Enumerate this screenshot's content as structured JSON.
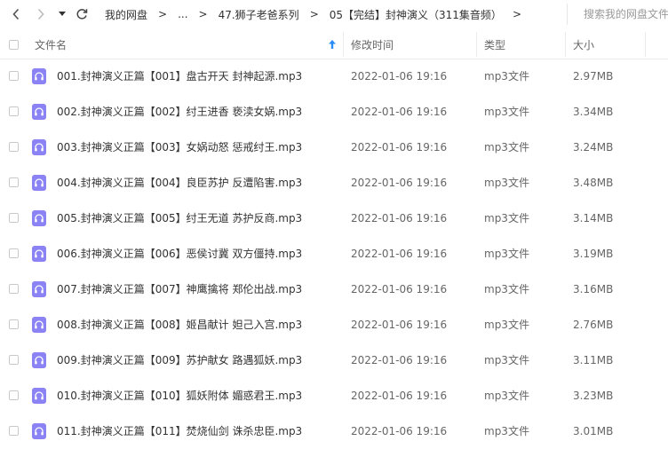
{
  "toolbar": {
    "back_icon": "chevron-left-icon",
    "forward_icon": "chevron-right-icon",
    "dropdown_icon": "caret-down-icon",
    "refresh_icon": "refresh-icon",
    "breadcrumb": [
      "我的网盘",
      "...",
      "47.狮子老爸系列",
      "05【完结】封神演义（311集音频）"
    ],
    "separator": ">",
    "search_placeholder": "搜索我的网盘文件"
  },
  "columns": {
    "name": "文件名",
    "sort_icon": "sort-up-arrow-icon",
    "modified": "修改时间",
    "type": "类型",
    "size": "大小"
  },
  "colors": {
    "accent": "#2a8cf7",
    "file_icon": "#8b83f3"
  },
  "files": [
    {
      "name": "001.封神演义正篇【001】盘古开天 封神起源.mp3",
      "modified": "2022-01-06 19:16",
      "type": "mp3文件",
      "size": "2.97MB"
    },
    {
      "name": "002.封神演义正篇【002】纣王进香 亵渎女娲.mp3",
      "modified": "2022-01-06 19:16",
      "type": "mp3文件",
      "size": "3.34MB"
    },
    {
      "name": "003.封神演义正篇【003】女娲动怒 惩戒纣王.mp3",
      "modified": "2022-01-06 19:16",
      "type": "mp3文件",
      "size": "3.24MB"
    },
    {
      "name": "004.封神演义正篇【004】良臣苏护 反遭陷害.mp3",
      "modified": "2022-01-06 19:16",
      "type": "mp3文件",
      "size": "3.48MB"
    },
    {
      "name": "005.封神演义正篇【005】纣王无道 苏护反商.mp3",
      "modified": "2022-01-06 19:16",
      "type": "mp3文件",
      "size": "3.14MB"
    },
    {
      "name": "006.封神演义正篇【006】恶侯讨冀 双方僵持.mp3",
      "modified": "2022-01-06 19:16",
      "type": "mp3文件",
      "size": "3.19MB"
    },
    {
      "name": "007.封神演义正篇【007】神鹰擒将 郑伦出战.mp3",
      "modified": "2022-01-06 19:16",
      "type": "mp3文件",
      "size": "3.16MB"
    },
    {
      "name": "008.封神演义正篇【008】姬昌献计 妲己入宫.mp3",
      "modified": "2022-01-06 19:16",
      "type": "mp3文件",
      "size": "2.76MB"
    },
    {
      "name": "009.封神演义正篇【009】苏护献女 路遇狐妖.mp3",
      "modified": "2022-01-06 19:16",
      "type": "mp3文件",
      "size": "3.11MB"
    },
    {
      "name": "010.封神演义正篇【010】狐妖附体 媚惑君王.mp3",
      "modified": "2022-01-06 19:16",
      "type": "mp3文件",
      "size": "3.23MB"
    },
    {
      "name": "011.封神演义正篇【011】焚烧仙剑 诛杀忠臣.mp3",
      "modified": "2022-01-06 19:16",
      "type": "mp3文件",
      "size": "3.01MB"
    }
  ]
}
